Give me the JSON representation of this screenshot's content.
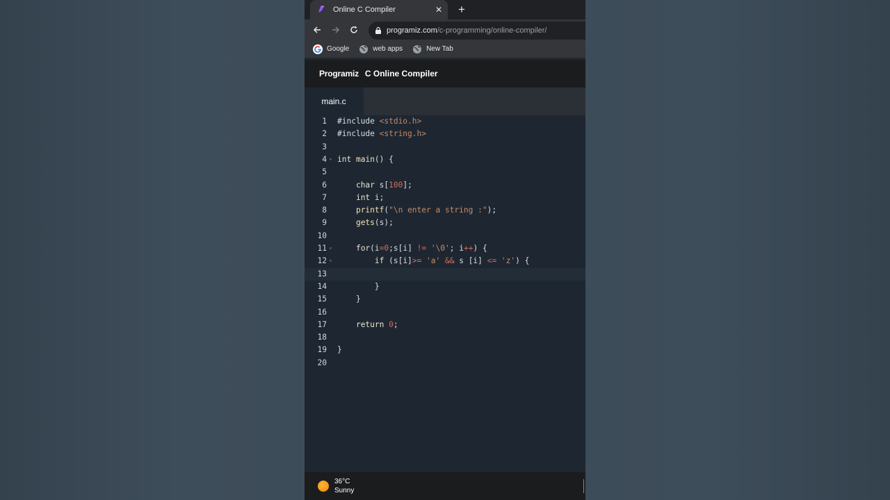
{
  "browser": {
    "tab_title": "Online C Compiler",
    "close_glyph": "✕",
    "newtab_glyph": "+",
    "url_host": "programiz.com",
    "url_path": "/c-programming/online-compiler/",
    "bookmarks": [
      {
        "label": "Google",
        "icon": "google-icon"
      },
      {
        "label": "web apps",
        "icon": "globe-icon"
      },
      {
        "label": "New Tab",
        "icon": "globe-icon"
      }
    ]
  },
  "site": {
    "logo_text": "Programiz",
    "title": "C Online Compiler"
  },
  "editor": {
    "file_name": "main.c",
    "lines": [
      {
        "n": "1",
        "text": "#include <stdio.h>"
      },
      {
        "n": "2",
        "text": "#include <string.h>"
      },
      {
        "n": "3",
        "text": ""
      },
      {
        "n": "4",
        "text": "int main() {"
      },
      {
        "n": "5",
        "text": ""
      },
      {
        "n": "6",
        "text": "    char s[100];"
      },
      {
        "n": "7",
        "text": "    int i;"
      },
      {
        "n": "8",
        "text": "    printf(\"\\n enter a string :\");"
      },
      {
        "n": "9",
        "text": "    gets(s);"
      },
      {
        "n": "10",
        "text": ""
      },
      {
        "n": "11",
        "text": "    for(i=0;s[i] != '\\0'; i++) {"
      },
      {
        "n": "12",
        "text": "        if (s[i]>= 'a' && s [i] <= 'z') {"
      },
      {
        "n": "13",
        "text": ""
      },
      {
        "n": "14",
        "text": "        }"
      },
      {
        "n": "15",
        "text": "    }"
      },
      {
        "n": "16",
        "text": ""
      },
      {
        "n": "17",
        "text": "    return 0;"
      },
      {
        "n": "18",
        "text": ""
      },
      {
        "n": "19",
        "text": "}"
      },
      {
        "n": "20",
        "text": ""
      }
    ]
  },
  "taskbar": {
    "temperature": "36°C",
    "condition": "Sunny"
  },
  "colors": {
    "accent_sun": "#f08a00",
    "editor_bg": "#1e2731",
    "string": "#c48b6a",
    "number": "#d86b5a"
  }
}
